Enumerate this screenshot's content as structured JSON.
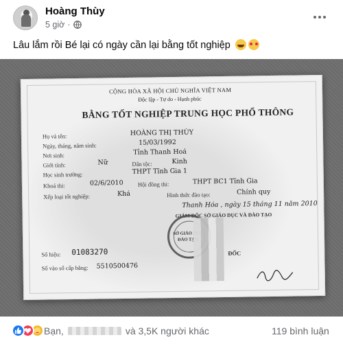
{
  "post": {
    "author": "Hoàng Thùy",
    "time": "5 giờ",
    "privacy_icon": "globe-icon",
    "more_icon": "more-dots-icon",
    "caption": "Lâu lắm rồi Bé lại có ngày cần lại bằng tốt nghiệp",
    "caption_emojis": [
      "grinning-sweat-emoji",
      "smiling-face-with-hearts-emoji"
    ]
  },
  "certificate": {
    "header_line1": "CỘNG HÒA XÃ HỘI CHỦ NGHĨA VIỆT NAM",
    "header_line2": "Độc lập - Tự do - Hạnh phúc",
    "title": "BẰNG TỐT NGHIỆP TRUNG HỌC PHỔ THÔNG",
    "fields": {
      "name_label": "Họ và tên:",
      "name_value": "HOÀNG THỊ THÙY",
      "dob_label": "Ngày, tháng, năm sinh:",
      "dob_value": "15/03/1992",
      "birthplace_label": "Nơi sinh:",
      "birthplace_value": "Tỉnh Thanh Hoá",
      "gender_label": "Giới tính:",
      "gender_value": "Nữ",
      "ethnicity_label": "Dân tộc:",
      "ethnicity_value": "Kinh",
      "school_label": "Học sinh trường:",
      "school_value": "THPT Tĩnh Gia 1",
      "exam_label": "Khoá thi:",
      "exam_value": "02/6/2010",
      "council_label": "Hội đồng thi:",
      "council_value": "THPT BC1 Tĩnh Gia",
      "mode_label": "Hình thức đào tạo:",
      "mode_value": "Chính quy",
      "grade_label": "Xếp loại tốt nghiệp:",
      "grade_value": "Khá",
      "place_date": "Thanh Hóa , ngày 15 tháng 11 năm 2010",
      "authority": "GIÁM ĐỐC SỞ GIÁO DỤC VÀ ĐÀO TẠO",
      "serial_label": "Số hiệu:",
      "serial_value": "01083270",
      "registry_label": "Số vào sổ cấp bằng:",
      "registry_value": "5510500476",
      "seal_text": "SỞ GIÁO DỤC ĐÀO TẠO",
      "signer_suffix": "ĐỐC",
      "signature_text": "Hoa"
    }
  },
  "footer": {
    "reactions": [
      "like-icon",
      "love-icon",
      "care-icon"
    ],
    "reactors_prefix": "Bạn,",
    "reactors_suffix": "và 3,5K người khác",
    "comments": "119 bình luận"
  },
  "colors": {
    "text_primary": "#050505",
    "text_secondary": "#65676b",
    "like_blue": "#1877f2",
    "love_red": "#f33e58",
    "care_yellow": "#f7b928"
  }
}
